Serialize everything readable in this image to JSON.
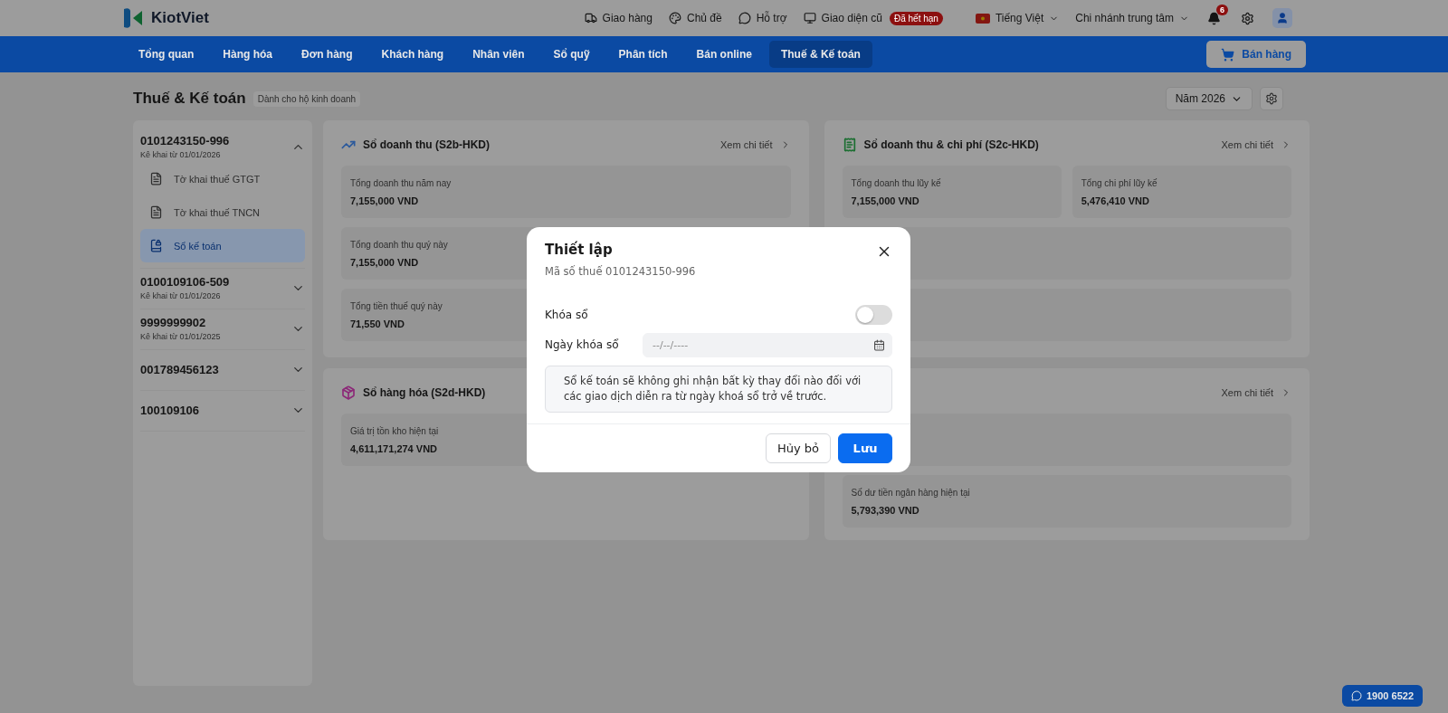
{
  "header": {
    "logo": "KiotViet",
    "links": [
      {
        "kind": "delivery",
        "label": "Giao hàng"
      },
      {
        "kind": "theme",
        "label": "Chủ đề"
      },
      {
        "kind": "support",
        "label": "Hỗ trợ"
      },
      {
        "kind": "monitor",
        "label": "Giao diện cũ",
        "badge": "Đã hết hạn"
      }
    ],
    "language": "Tiếng Việt",
    "branch": "Chi nhánh trung tâm",
    "notification_count": "6"
  },
  "nav": {
    "tabs": [
      {
        "label": "Tổng quan",
        "selected": false
      },
      {
        "label": "Hàng hóa",
        "selected": false
      },
      {
        "label": "Đơn hàng",
        "selected": false
      },
      {
        "label": "Khách hàng",
        "selected": false
      },
      {
        "label": "Nhân viên",
        "selected": false
      },
      {
        "label": "Sổ quỹ",
        "selected": false
      },
      {
        "label": "Phân tích",
        "selected": false
      },
      {
        "label": "Bán online",
        "selected": false
      },
      {
        "label": "Thuế & Kế toán",
        "selected": true
      }
    ],
    "sell_button": "Bán hàng"
  },
  "page": {
    "title": "Thuế & Kế toán",
    "tag": "Dành cho hộ kinh doanh",
    "year_select": "Năm 2026"
  },
  "sidebar": {
    "groups": [
      {
        "code": "0101243150-996",
        "subtitle": "Kê khai từ 01/01/2026",
        "expanded": true,
        "items": [
          {
            "kind": "doc",
            "label": "Tờ khai thuế GTGT",
            "selected": false
          },
          {
            "kind": "doc",
            "label": "Tờ khai thuế TNCN",
            "selected": false
          },
          {
            "kind": "book",
            "label": "Sổ kế toán",
            "selected": true
          }
        ]
      },
      {
        "code": "0100109106-509",
        "subtitle": "Kê khai từ 01/01/2026",
        "expanded": false
      },
      {
        "code": "9999999902",
        "subtitle": "Kê khai từ 01/01/2025",
        "expanded": false
      },
      {
        "code": "001789456123",
        "expanded": false
      },
      {
        "code": "100109106",
        "expanded": false
      }
    ]
  },
  "cards": [
    {
      "kind": "chart",
      "color": "#2c5a9c",
      "title": "Sổ doanh thu (S2b-HKD)",
      "link": "Xem chi tiết",
      "rows": [
        [
          {
            "label": "Tổng doanh thu năm nay",
            "value": "7,155,000 VND"
          }
        ],
        [
          {
            "label": "Tổng doanh thu quý này",
            "value": "7,155,000 VND"
          }
        ],
        [
          {
            "label": "Tổng tiền thuế quý này",
            "value": "71,550 VND"
          }
        ]
      ]
    },
    {
      "kind": "ledger",
      "color": "#1a6e30",
      "title": "Sổ doanh thu & chi phí (S2c-HKD)",
      "link": "Xem chi tiết",
      "rows": [
        [
          {
            "label": "Tổng doanh thu lũy kế",
            "value": "7,155,000 VND"
          },
          {
            "label": "Tổng chi phí lũy kế",
            "value": "5,476,410 VND"
          }
        ],
        [],
        []
      ]
    },
    {
      "kind": "box",
      "color": "#8c2878",
      "title": "Sổ hàng hóa (S2d-HKD)",
      "rows": [
        [
          {
            "label": "Giá trị tồn kho hiện tại",
            "value": "4,611,171,274 VND"
          }
        ]
      ]
    },
    {
      "kind": "bank",
      "link": "Xem chi tiết",
      "rows": [
        [],
        [
          {
            "label": "Số dư tiền ngân hàng hiện tại",
            "value": "5,793,390 VND"
          }
        ]
      ]
    }
  ],
  "hotline": "1900 6522",
  "dialog": {
    "title": "Thiết lập",
    "subtitle": "Mã số thuế 0101243150-996",
    "lock": {
      "label": "Khóa sổ",
      "on": false
    },
    "date": {
      "label": "Ngày khóa sổ",
      "placeholder": "--/--/----",
      "disabled": true
    },
    "note": "Sổ kế toán sẽ không ghi nhận bất kỳ thay đổi nào đối với các giao dịch diễn ra từ ngày khoá sổ trở về trước.",
    "buttons": [
      {
        "kind": "secondary",
        "label": "Hủy bỏ"
      },
      {
        "kind": "primary",
        "label": "Lưu"
      }
    ]
  }
}
